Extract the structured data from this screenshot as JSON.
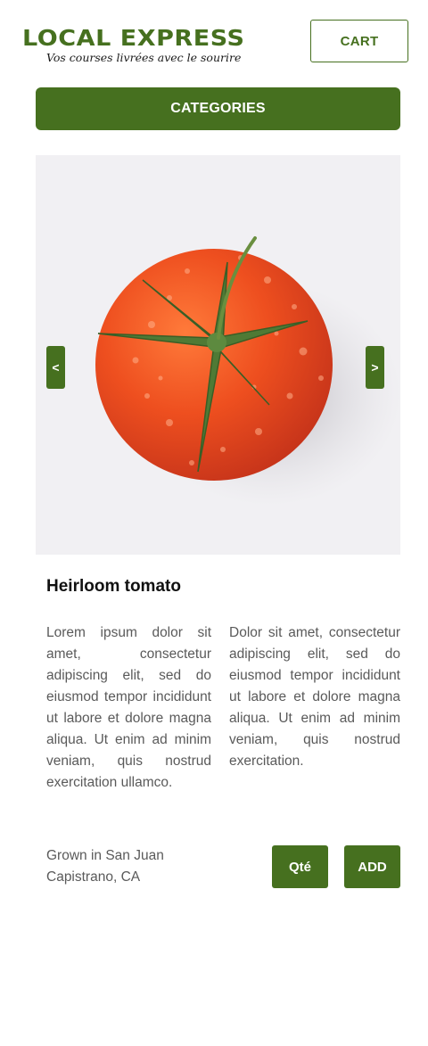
{
  "header": {
    "logo_title": "LOCAL EXPRESS",
    "logo_tagline": "Vos courses livrées avec le sourire",
    "cart_label": "CART"
  },
  "nav": {
    "categories_label": "CATEGORIES"
  },
  "carousel": {
    "prev_label": "<",
    "next_label": ">",
    "image_subject": "tomato"
  },
  "product": {
    "title": "Heirloom tomato",
    "description_left": "Lorem ipsum dolor sit amet, consectetur adipiscing elit, sed do eiusmod tempor incididunt ut labore et dolore magna aliqua. Ut enim ad minim veniam, quis nostrud exercitation ullamco.",
    "description_right": "Dolor sit amet, consectetur adipiscing elit, sed do eiusmod tempor incididunt ut labore et dolore magna aliqua. Ut enim ad minim veniam, quis nostrud exercitation.",
    "origin": "Grown in San Juan Capistrano, CA",
    "qty_label": "Qté",
    "add_label": "ADD"
  },
  "colors": {
    "brand_green": "#46701f",
    "photo_bg": "#f1f0f3",
    "tomato_red": "#e8451d"
  }
}
